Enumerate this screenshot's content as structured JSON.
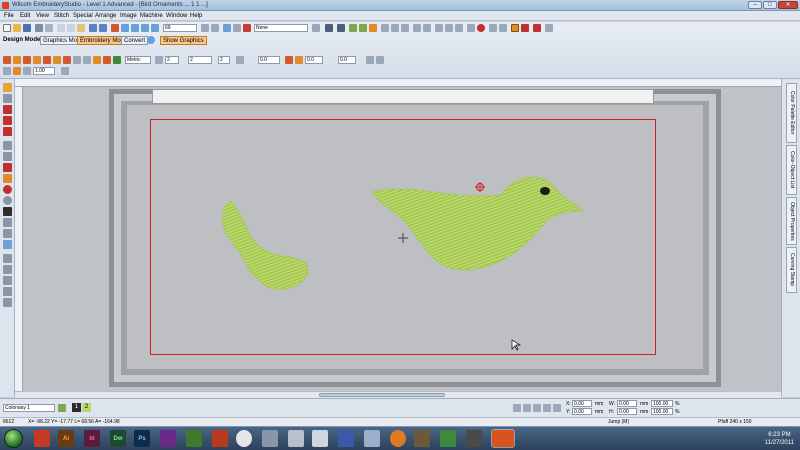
{
  "window": {
    "title": "Wilcom EmbroideryStudio - Level 1 Advanced - [Bird Ornaments ... 1 1 ...]",
    "controls": {
      "minimize": "–",
      "maximize": "□",
      "close": "✕"
    }
  },
  "menu": [
    "File",
    "Edit",
    "View",
    "Stitch",
    "Special",
    "Arrange",
    "Image",
    "Machine",
    "Window",
    "Help"
  ],
  "toolbar": {
    "zoom_value": "69",
    "style_value": "None",
    "design_mode_label": "Design Mode:",
    "graphics_mode_label": "Graphics Mode",
    "embroidery_mode_label": "Embroidery Mode",
    "convert_label": "Convert",
    "show_graphics_label": "Show Graphics",
    "units_value": "Metric",
    "width_value": "1.00",
    "field_a": "2",
    "field_b": "2",
    "field_c": "2",
    "field_d": "0.0",
    "field_e": "0.0",
    "field_f": "0.0"
  },
  "side_tabs": [
    "Color Palette Editor",
    "Color-Object List",
    "Object Properties",
    "Carving Stamp"
  ],
  "bottom": {
    "colorway": "Colorway 1",
    "swatch_1": "1",
    "swatch_2": "2",
    "x_label": "X:",
    "x_value": "0.00",
    "w_label": "W:",
    "w_value": "0.00",
    "x_pct": "100.00",
    "y_label": "Y:",
    "y_value": "0.00",
    "h_label": "H:",
    "h_value": "0.00",
    "y_pct": "100.00",
    "unit_mm": "mm",
    "unit_pct": "%"
  },
  "status": {
    "count": "8612",
    "coords": "X= -98.22 Y= -17.77 L= 68.56 A= -164.98",
    "mode": "Jump (M)",
    "hoop": "Pfaff 240 x 150"
  },
  "taskbar": {
    "items": [
      "Ai",
      "Id",
      "Dw",
      "Ps",
      "",
      "",
      "",
      "",
      "",
      "",
      "",
      "",
      "",
      "",
      ""
    ],
    "time": "6:23 PM",
    "date": "11/27/2011"
  },
  "colors": {
    "embroidery_green": "#b9d86a",
    "needle_mark": "#d01e2a",
    "sew_area_border": "#d01e2a"
  }
}
